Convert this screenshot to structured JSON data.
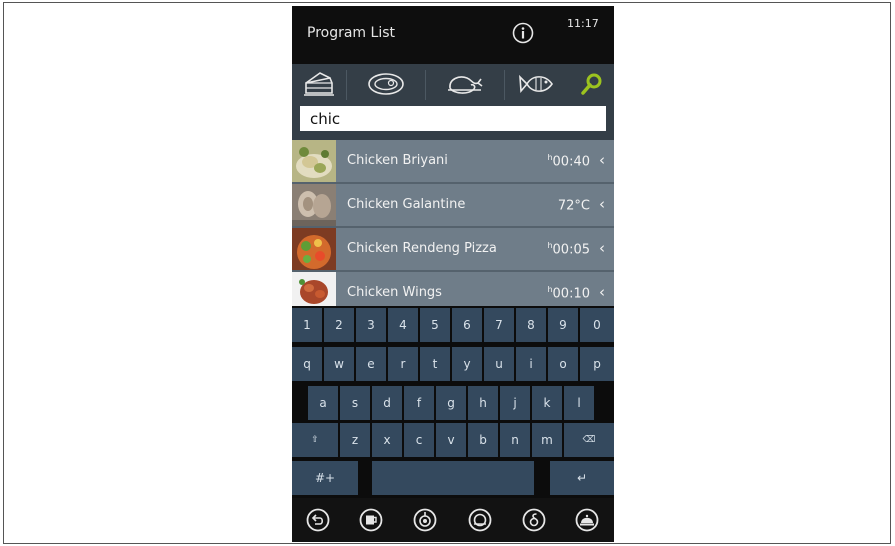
{
  "header": {
    "title": "Program List",
    "time": "11:17",
    "info_icon": "info-icon"
  },
  "categories": [
    {
      "name": "cake-icon"
    },
    {
      "name": "steak-icon"
    },
    {
      "name": "poultry-icon"
    },
    {
      "name": "fish-icon"
    },
    {
      "name": "search-icon",
      "color": "#9cc31f"
    }
  ],
  "search": {
    "value": "chic"
  },
  "programs": [
    {
      "name": "Chicken Briyani",
      "time": "00:40",
      "time_prefix": "h",
      "arrow": "‹"
    },
    {
      "name": "Chicken Galantine",
      "time": "72°C",
      "time_prefix": "",
      "arrow": "‹"
    },
    {
      "name": "Chicken Rendeng Pizza",
      "time": "00:05",
      "time_prefix": "h",
      "arrow": "‹"
    },
    {
      "name": "Chicken Wings",
      "time": "00:10",
      "time_prefix": "h",
      "arrow": "‹"
    }
  ],
  "keyboard": {
    "row1": [
      "1",
      "2",
      "3",
      "4",
      "5",
      "6",
      "7",
      "8",
      "9",
      "0"
    ],
    "row2": [
      "q",
      "w",
      "e",
      "r",
      "t",
      "y",
      "u",
      "i",
      "o",
      "p"
    ],
    "row3": [
      "a",
      "s",
      "d",
      "f",
      "g",
      "h",
      "j",
      "k",
      "l"
    ],
    "row4_letters": [
      "z",
      "x",
      "c",
      "v",
      "b",
      "n",
      "m"
    ],
    "shift": "⇧",
    "backspace": "⌫",
    "symbols": "#+",
    "enter": "↵"
  },
  "bottom_nav": [
    "back-icon",
    "cup-icon",
    "cooking-mode-icon",
    "plate-icon",
    "delta-icon",
    "cloche-icon"
  ],
  "colors": {
    "accent": "#9cc31f",
    "list_row": "#6f7d89",
    "key_bg": "#34495e"
  }
}
